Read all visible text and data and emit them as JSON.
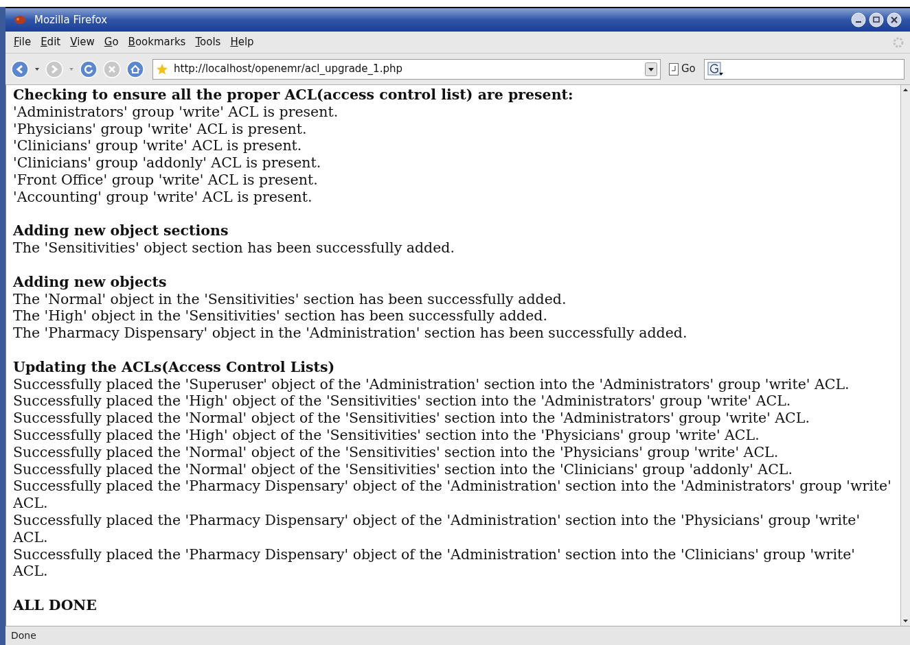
{
  "window": {
    "title": "Mozilla Firefox"
  },
  "menu": [
    "File",
    "Edit",
    "View",
    "Go",
    "Bookmarks",
    "Tools",
    "Help"
  ],
  "toolbar": {
    "url": "http://localhost/openemr/acl_upgrade_1.php",
    "go": "Go"
  },
  "sections": [
    {
      "heading": "Checking to ensure all the proper ACL(access control list) are present:",
      "lines": [
        "'Administrators' group 'write' ACL is present.",
        "'Physicians' group 'write' ACL is present.",
        "'Clinicians' group 'write' ACL is present.",
        "'Clinicians' group 'addonly' ACL is present.",
        "'Front Office' group 'write' ACL is present.",
        "'Accounting' group 'write' ACL is present."
      ]
    },
    {
      "heading": "Adding new object sections",
      "lines": [
        "The 'Sensitivities' object section has been successfully added."
      ]
    },
    {
      "heading": "Adding new objects",
      "lines": [
        "The 'Normal' object in the 'Sensitivities' section has been successfully added.",
        "The 'High' object in the 'Sensitivities' section has been successfully added.",
        "The 'Pharmacy Dispensary' object in the 'Administration' section has been successfully added."
      ]
    },
    {
      "heading": "Updating the ACLs(Access Control Lists)",
      "lines": [
        "Successfully placed the 'Superuser' object of the 'Administration' section into the 'Administrators' group 'write' ACL.",
        "Successfully placed the 'High' object of the 'Sensitivities' section into the 'Administrators' group 'write' ACL.",
        "Successfully placed the 'Normal' object of the 'Sensitivities' section into the 'Administrators' group 'write' ACL.",
        "Successfully placed the 'High' object of the 'Sensitivities' section into the 'Physicians' group 'write' ACL.",
        "Successfully placed the 'Normal' object of the 'Sensitivities' section into the 'Physicians' group 'write' ACL.",
        "Successfully placed the 'Normal' object of the 'Sensitivities' section into the 'Clinicians' group 'addonly' ACL.",
        "Successfully placed the 'Pharmacy Dispensary' object of the 'Administration' section into the 'Administrators' group 'write' ACL.",
        "Successfully placed the 'Pharmacy Dispensary' object of the 'Administration' section into the 'Physicians' group 'write' ACL.",
        "Successfully placed the 'Pharmacy Dispensary' object of the 'Administration' section into the 'Clinicians' group 'write' ACL."
      ]
    },
    {
      "heading": "ALL DONE"
    }
  ],
  "status_bar": "Done"
}
